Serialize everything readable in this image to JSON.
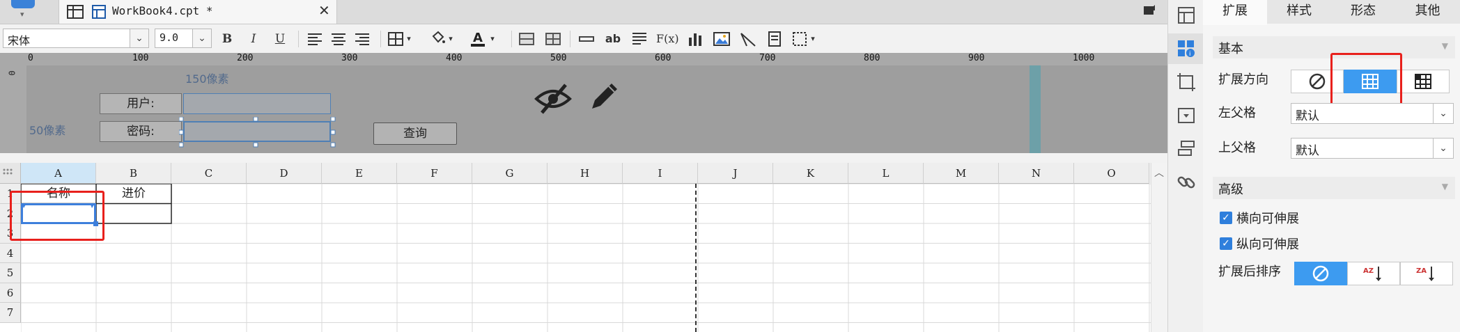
{
  "tabbar": {
    "tab_label": "WorkBook4.cpt *",
    "close_glyph": "✕"
  },
  "toolbar": {
    "font_family": "宋体",
    "font_size": "9.0",
    "bold_label": "B",
    "italic_label": "I",
    "underline_label": "U",
    "text_ab": "ab",
    "formula_label": "F(x)"
  },
  "ruler": {
    "labels": [
      "0",
      "100",
      "200",
      "300",
      "400",
      "500",
      "600",
      "700",
      "800",
      "900",
      "1000"
    ],
    "vertical_label": "0"
  },
  "param_pane": {
    "width_hint": "150像素",
    "height_hint": "50像素",
    "user_label": "用户:",
    "password_label": "密码:",
    "query_button": "查询",
    "user_value": "",
    "password_value": ""
  },
  "sheet": {
    "columns": [
      "A",
      "B",
      "C",
      "D",
      "E",
      "F",
      "G",
      "H",
      "I",
      "J",
      "K",
      "L",
      "M",
      "N",
      "O"
    ],
    "rows": [
      "1",
      "2",
      "3",
      "4",
      "5",
      "6",
      "7"
    ],
    "cells": {
      "A1": "名称",
      "B1": "进价"
    }
  },
  "right_panel": {
    "tabs": [
      "扩展",
      "样式",
      "形态",
      "其他"
    ],
    "active_tab": "扩展",
    "basic_section": "基本",
    "expand_direction_label": "扩展方向",
    "left_parent_label": "左父格",
    "left_parent_value": "默认",
    "top_parent_label": "上父格",
    "top_parent_value": "默认",
    "advanced_section": "高级",
    "horizontal_extend": "横向可伸展",
    "vertical_extend": "纵向可伸展",
    "sort_label": "扩展后排序",
    "horizontal_extend_checked": true,
    "vertical_extend_checked": true,
    "sort_asc_icon_text": "AZ",
    "sort_desc_icon_text": "ZA"
  },
  "colors": {
    "accent": "#3d9bf0",
    "annotation_red": "#e8201c",
    "param_bg": "#9e9e9e"
  }
}
